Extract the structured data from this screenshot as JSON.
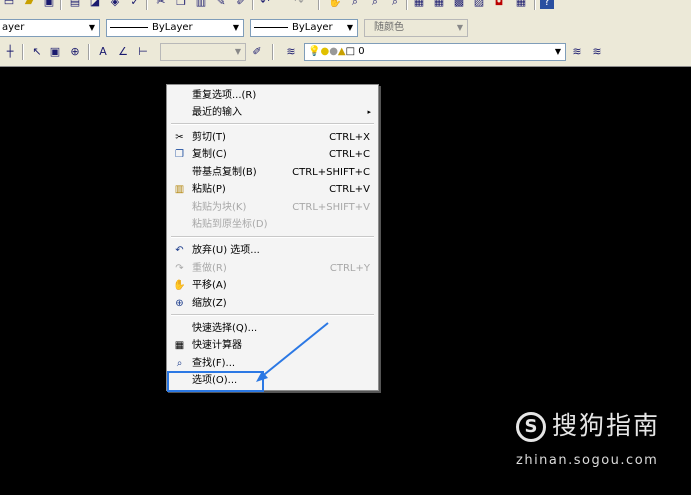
{
  "toolbar": {
    "layer_combo": "ayer",
    "linetype_combo": "ByLayer",
    "lineweight_combo": "ByLayer",
    "color_combo": "随颜色",
    "layer_name": "0"
  },
  "context_menu": {
    "items": [
      {
        "label": "重复选项...(R)",
        "shortcut": "",
        "disabled": false,
        "icon": ""
      },
      {
        "label": "最近的输入",
        "shortcut": "",
        "disabled": false,
        "icon": "",
        "submenu": "▸"
      },
      {
        "label": "剪切(T)",
        "shortcut": "CTRL+X",
        "disabled": false,
        "icon": "scissors-icon"
      },
      {
        "label": "复制(C)",
        "shortcut": "CTRL+C",
        "disabled": false,
        "icon": "copy-icon"
      },
      {
        "label": "带基点复制(B)",
        "shortcut": "CTRL+SHIFT+C",
        "disabled": false,
        "icon": ""
      },
      {
        "label": "粘贴(P)",
        "shortcut": "CTRL+V",
        "disabled": false,
        "icon": "paste-icon"
      },
      {
        "label": "粘贴为块(K)",
        "shortcut": "CTRL+SHIFT+V",
        "disabled": true,
        "icon": ""
      },
      {
        "label": "粘贴到原坐标(D)",
        "shortcut": "",
        "disabled": true,
        "icon": ""
      },
      {
        "label": "放弃(U) 选项...",
        "shortcut": "",
        "disabled": false,
        "icon": "undo-icon"
      },
      {
        "label": "重做(R)",
        "shortcut": "CTRL+Y",
        "disabled": true,
        "icon": "redo-icon"
      },
      {
        "label": "平移(A)",
        "shortcut": "",
        "disabled": false,
        "icon": "pan-icon"
      },
      {
        "label": "缩放(Z)",
        "shortcut": "",
        "disabled": false,
        "icon": "zoom-icon"
      },
      {
        "label": "快速选择(Q)...",
        "shortcut": "",
        "disabled": false,
        "icon": ""
      },
      {
        "label": "快速计算器",
        "shortcut": "",
        "disabled": false,
        "icon": "calculator-icon"
      },
      {
        "label": "查找(F)...",
        "shortcut": "",
        "disabled": false,
        "icon": "find-icon"
      },
      {
        "label": "选项(O)...",
        "shortcut": "",
        "disabled": false,
        "icon": ""
      }
    ]
  },
  "watermark": {
    "title": "搜狗指南",
    "url": "zhinan.sogou.com"
  },
  "colors": {
    "canvas": "#000000",
    "menu_bg": "#f4f4f4",
    "annotation": "#2b78e4",
    "toolbar_bg": "#ece9d8"
  }
}
